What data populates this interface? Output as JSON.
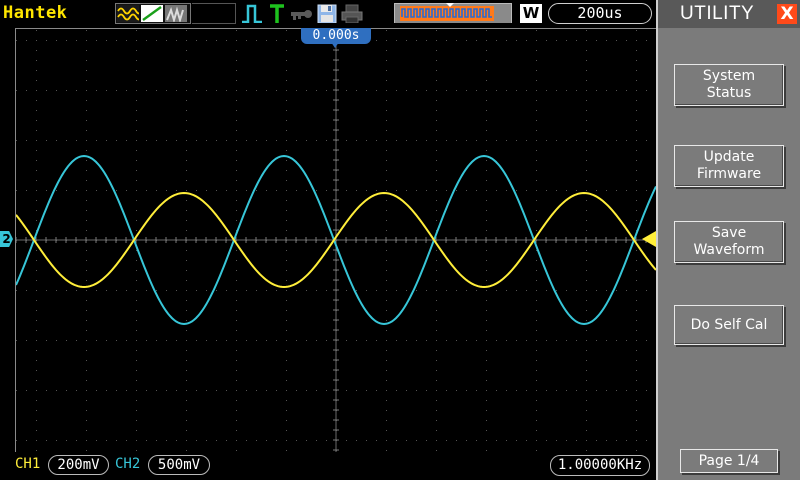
{
  "topbar": {
    "brand": "Hantek",
    "mode_letter": "W",
    "timebase": "200us",
    "icons": [
      "acquire-normal-icon",
      "acquire-peak-icon",
      "acquire-average-icon",
      "trigger-edge-icon",
      "trigger-T-icon",
      "key-icon",
      "save-disk-icon",
      "printer-icon",
      "memory-position-icon"
    ]
  },
  "screen": {
    "trigger_time": "0.000s"
  },
  "channels": {
    "ch1": {
      "label": "CH1",
      "scale": "200mV",
      "color": "#ffee3a"
    },
    "ch2": {
      "label": "CH2",
      "scale": "500mV",
      "color": "#37c6d8",
      "marker": "2"
    }
  },
  "bottombar": {
    "frequency": "1.00000KHz"
  },
  "menu": {
    "title": "UTILITY",
    "close": "X",
    "buttons": [
      {
        "label": "System\nStatus"
      },
      {
        "label": "Update\nFirmware"
      },
      {
        "label": "Save\nWaveform"
      },
      {
        "label": "Do Self Cal"
      }
    ],
    "page": "Page 1/4"
  },
  "colors": {
    "brand": "#ffe600",
    "menu_bg": "#7b7b7b",
    "close_bg": "#ff4a1a",
    "trigger_tag": "#2f6fc0"
  }
}
